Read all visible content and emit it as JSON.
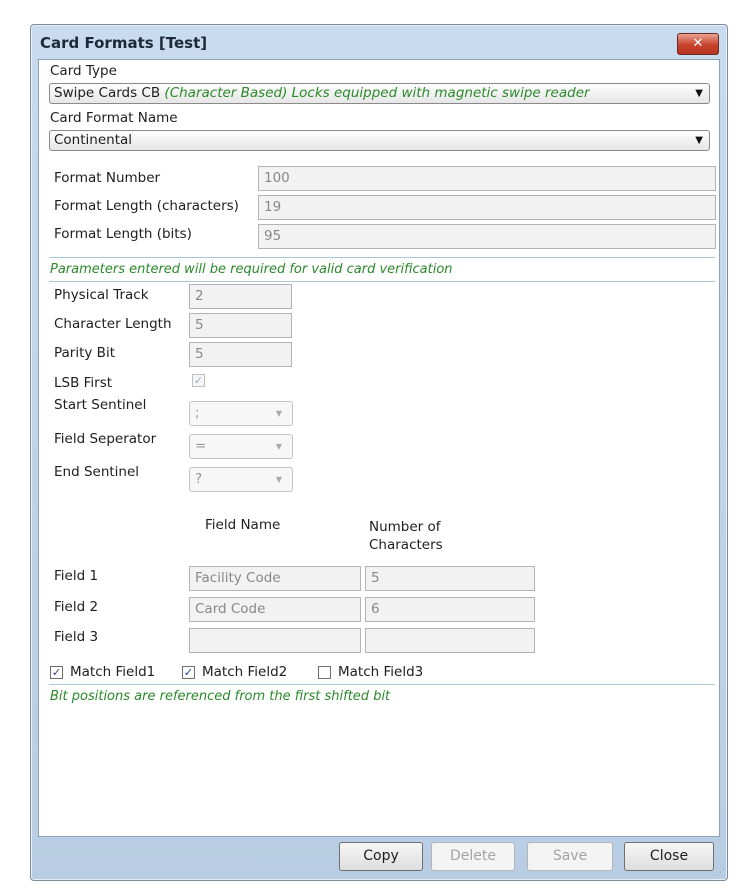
{
  "window": {
    "title": "Card Formats [Test]",
    "close_glyph": "✕"
  },
  "card_type": {
    "label": "Card Type",
    "value_main": "Swipe Cards CB",
    "value_desc": "(Character Based) Locks equipped with magnetic swipe reader"
  },
  "card_format_name": {
    "label": "Card Format Name",
    "value": "Continental"
  },
  "format": {
    "number_label": "Format Number",
    "number_value": "100",
    "length_chars_label": "Format Length (characters)",
    "length_chars_value": "19",
    "length_bits_label": "Format Length (bits)",
    "length_bits_value": "95"
  },
  "params_note": "Parameters entered will be required for valid card verification",
  "params": {
    "physical_track_label": "Physical Track",
    "physical_track_value": "2",
    "char_length_label": "Character Length",
    "char_length_value": "5",
    "parity_bit_label": "Parity Bit",
    "parity_bit_value": "5",
    "lsb_first_label": "LSB First",
    "lsb_first_checked": true,
    "start_sentinel_label": "Start Sentinel",
    "start_sentinel_value": ";",
    "field_sep_label": "Field Seperator",
    "field_sep_value": "=",
    "end_sentinel_label": "End Sentinel",
    "end_sentinel_value": "?"
  },
  "fields_table": {
    "col_name": "Field Name",
    "col_count": "Number of Characters",
    "rows": [
      {
        "label": "Field 1",
        "name": "Facility Code",
        "count": "5"
      },
      {
        "label": "Field 2",
        "name": "Card Code",
        "count": "6"
      },
      {
        "label": "Field 3",
        "name": "",
        "count": ""
      }
    ]
  },
  "match": [
    {
      "label": "Match Field1",
      "checked": true
    },
    {
      "label": "Match Field2",
      "checked": true
    },
    {
      "label": "Match Field3",
      "checked": false
    }
  ],
  "bit_note": "Bit positions are referenced from the first shifted bit",
  "buttons": {
    "copy": "Copy",
    "delete": "Delete",
    "save": "Save",
    "close": "Close"
  },
  "colors": {
    "title_bar": "#c9dbee",
    "note_green": "#2a8a2a",
    "close_red": "#c8412c"
  }
}
